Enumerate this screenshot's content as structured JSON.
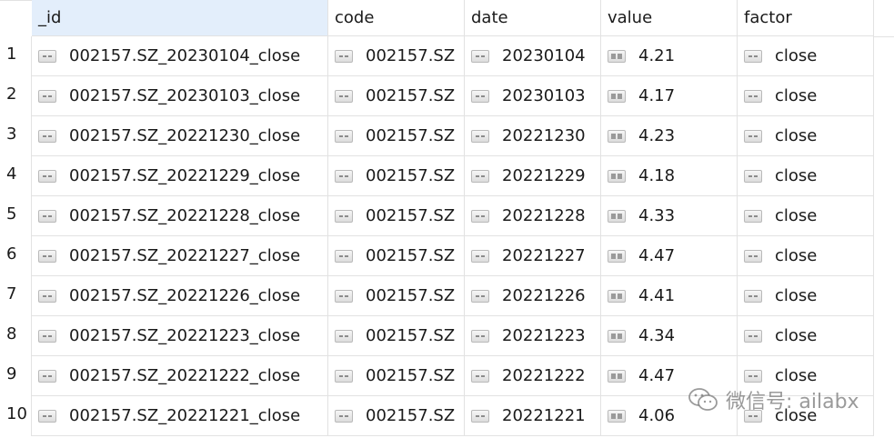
{
  "columns": [
    {
      "key": "id",
      "label": "_id"
    },
    {
      "key": "code",
      "label": "code"
    },
    {
      "key": "date",
      "label": "date"
    },
    {
      "key": "value",
      "label": "value"
    },
    {
      "key": "factor",
      "label": "factor"
    }
  ],
  "rows": [
    {
      "num": "1",
      "id": "002157.SZ_20230104_close",
      "code": "002157.SZ",
      "date": "20230104",
      "value": "4.21",
      "factor": "close"
    },
    {
      "num": "2",
      "id": "002157.SZ_20230103_close",
      "code": "002157.SZ",
      "date": "20230103",
      "value": "4.17",
      "factor": "close"
    },
    {
      "num": "3",
      "id": "002157.SZ_20221230_close",
      "code": "002157.SZ",
      "date": "20221230",
      "value": "4.23",
      "factor": "close"
    },
    {
      "num": "4",
      "id": "002157.SZ_20221229_close",
      "code": "002157.SZ",
      "date": "20221229",
      "value": "4.18",
      "factor": "close"
    },
    {
      "num": "5",
      "id": "002157.SZ_20221228_close",
      "code": "002157.SZ",
      "date": "20221228",
      "value": "4.33",
      "factor": "close"
    },
    {
      "num": "6",
      "id": "002157.SZ_20221227_close",
      "code": "002157.SZ",
      "date": "20221227",
      "value": "4.47",
      "factor": "close"
    },
    {
      "num": "7",
      "id": "002157.SZ_20221226_close",
      "code": "002157.SZ",
      "date": "20221226",
      "value": "4.41",
      "factor": "close"
    },
    {
      "num": "8",
      "id": "002157.SZ_20221223_close",
      "code": "002157.SZ",
      "date": "20221223",
      "value": "4.34",
      "factor": "close"
    },
    {
      "num": "9",
      "id": "002157.SZ_20221222_close",
      "code": "002157.SZ",
      "date": "20221222",
      "value": "4.47",
      "factor": "close"
    },
    {
      "num": "10",
      "id": "002157.SZ_20221221_close",
      "code": "002157.SZ",
      "date": "20221221",
      "value": "4.06",
      "factor": "close"
    }
  ],
  "watermark": {
    "text": "微信号: ailabx",
    "icon": "wechat-icon"
  },
  "icons": {
    "text_field": "string-field-icon",
    "number_field": "number-field-icon"
  },
  "colors": {
    "selected_header": "#e3eefb",
    "grid_line": "#e2e2e2"
  }
}
